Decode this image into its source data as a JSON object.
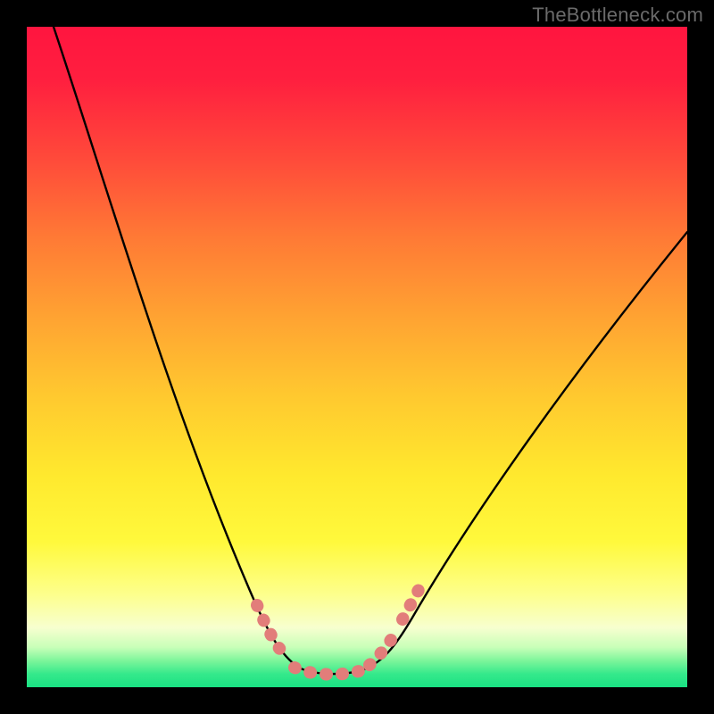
{
  "watermark": "TheBottleneck.com",
  "chart_data": {
    "type": "line",
    "title": "",
    "xlabel": "",
    "ylabel": "",
    "xlim": [
      0,
      100
    ],
    "ylim": [
      0,
      100
    ],
    "grid": false,
    "legend": false,
    "series": [
      {
        "name": "bottleneck-curve",
        "color": "#000000",
        "x": [
          0,
          5,
          10,
          15,
          20,
          25,
          30,
          35,
          38,
          40,
          42,
          44,
          46,
          48,
          50,
          52,
          55,
          60,
          65,
          70,
          75,
          80,
          85,
          90,
          95,
          100
        ],
        "y": [
          100,
          89,
          78,
          67,
          56,
          45,
          34,
          22,
          13,
          7,
          3,
          1,
          1,
          1,
          2,
          3,
          6,
          13,
          21,
          29,
          37,
          45,
          53,
          61,
          68,
          75
        ]
      },
      {
        "name": "optimal-range-markers",
        "color": "#e27d7a",
        "type": "scatter",
        "x": [
          37,
          38.5,
          40,
          41,
          42,
          43,
          44,
          45,
          46,
          47,
          48,
          49,
          50,
          51,
          52,
          53
        ],
        "y": [
          9,
          6,
          3.5,
          2.5,
          2,
          1.5,
          1.2,
          1.1,
          1.1,
          1.2,
          1.5,
          2,
          2.5,
          3.5,
          6,
          9
        ]
      }
    ],
    "background_gradient": {
      "orientation": "vertical",
      "stops": [
        {
          "pos": 0.0,
          "color": "#ff153f"
        },
        {
          "pos": 0.32,
          "color": "#ff7a35"
        },
        {
          "pos": 0.68,
          "color": "#ffe92e"
        },
        {
          "pos": 0.91,
          "color": "#f7ffcf"
        },
        {
          "pos": 1.0,
          "color": "#19e183"
        }
      ]
    }
  }
}
